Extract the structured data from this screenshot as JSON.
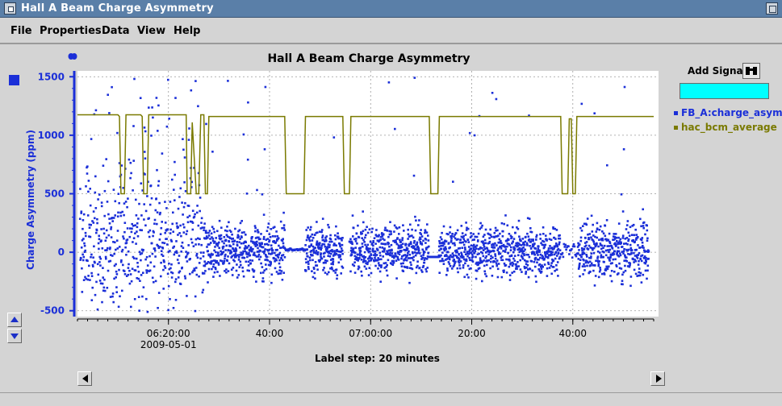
{
  "window": {
    "title": "Hall A Beam Charge Asymmetry"
  },
  "menu": {
    "items": [
      "File",
      "Properties",
      "Data",
      "View",
      "Help"
    ]
  },
  "chart_data": {
    "type": "scatter",
    "title": "Hall A Beam Charge Asymmetry",
    "ylabel": "Charge Asymmetry (ppm)",
    "xlabel": "Label step: 20 minutes",
    "ylim": [
      -550,
      1550
    ],
    "yticks": [
      -500,
      0,
      500,
      1000,
      1500
    ],
    "x_range_minutes": [
      0,
      114
    ],
    "xticks": [
      {
        "minute": 18,
        "label": "06:20:00",
        "sublabel": "2009-05-01"
      },
      {
        "minute": 38,
        "label": "40:00",
        "sublabel": ""
      },
      {
        "minute": 58,
        "label": "07:00:00",
        "sublabel": ""
      },
      {
        "minute": 78,
        "label": "20:00",
        "sublabel": ""
      },
      {
        "minute": 98,
        "label": "40:00",
        "sublabel": ""
      }
    ],
    "grid": true,
    "legend_placement": "right",
    "series": [
      {
        "name": "FB_A:charge_asym",
        "style": "points",
        "color": "#1b2fd8"
      },
      {
        "name": "hac_bcm_average",
        "style": "line",
        "color": "#7a7a00",
        "points": [
          [
            0,
            1175
          ],
          [
            8,
            1175
          ],
          [
            8.3,
            1160
          ],
          [
            8.6,
            500
          ],
          [
            9.3,
            500
          ],
          [
            9.6,
            1175
          ],
          [
            12.5,
            1175
          ],
          [
            12.8,
            1160
          ],
          [
            13.1,
            500
          ],
          [
            13.8,
            500
          ],
          [
            14.1,
            1175
          ],
          [
            21.5,
            1175
          ],
          [
            21.7,
            500
          ],
          [
            22.4,
            500
          ],
          [
            22.7,
            1110
          ],
          [
            23.5,
            500
          ],
          [
            24,
            500
          ],
          [
            24.4,
            1175
          ],
          [
            25,
            1175
          ],
          [
            25.3,
            500
          ],
          [
            25.7,
            500
          ],
          [
            26,
            1160
          ],
          [
            41,
            1160
          ],
          [
            41.3,
            500
          ],
          [
            44.8,
            500
          ],
          [
            45.1,
            1160
          ],
          [
            52.5,
            1160
          ],
          [
            52.8,
            500
          ],
          [
            53.8,
            500
          ],
          [
            54.1,
            1160
          ],
          [
            69.6,
            1160
          ],
          [
            69.9,
            500
          ],
          [
            71.3,
            500
          ],
          [
            71.6,
            1160
          ],
          [
            95.6,
            1160
          ],
          [
            95.9,
            500
          ],
          [
            97,
            500
          ],
          [
            97.3,
            1140
          ],
          [
            97.7,
            1140
          ],
          [
            98,
            500
          ],
          [
            98.5,
            500
          ],
          [
            98.8,
            1160
          ],
          [
            114,
            1160
          ]
        ]
      }
    ]
  },
  "side_panel": {
    "add_signal_label": "Add Signal",
    "signal_input_value": ""
  },
  "colors": {
    "window_bg": "#d4d4d4",
    "titlebar": "#5a7fa8",
    "asym": "#1b2fd8",
    "bcm": "#7a7a00",
    "input_bg": "#00ffff"
  },
  "icons": {
    "search": "binoculars-icon",
    "up": "arrow-up-icon",
    "down": "arrow-down-icon",
    "left": "arrow-left-icon",
    "right": "arrow-right-icon"
  }
}
